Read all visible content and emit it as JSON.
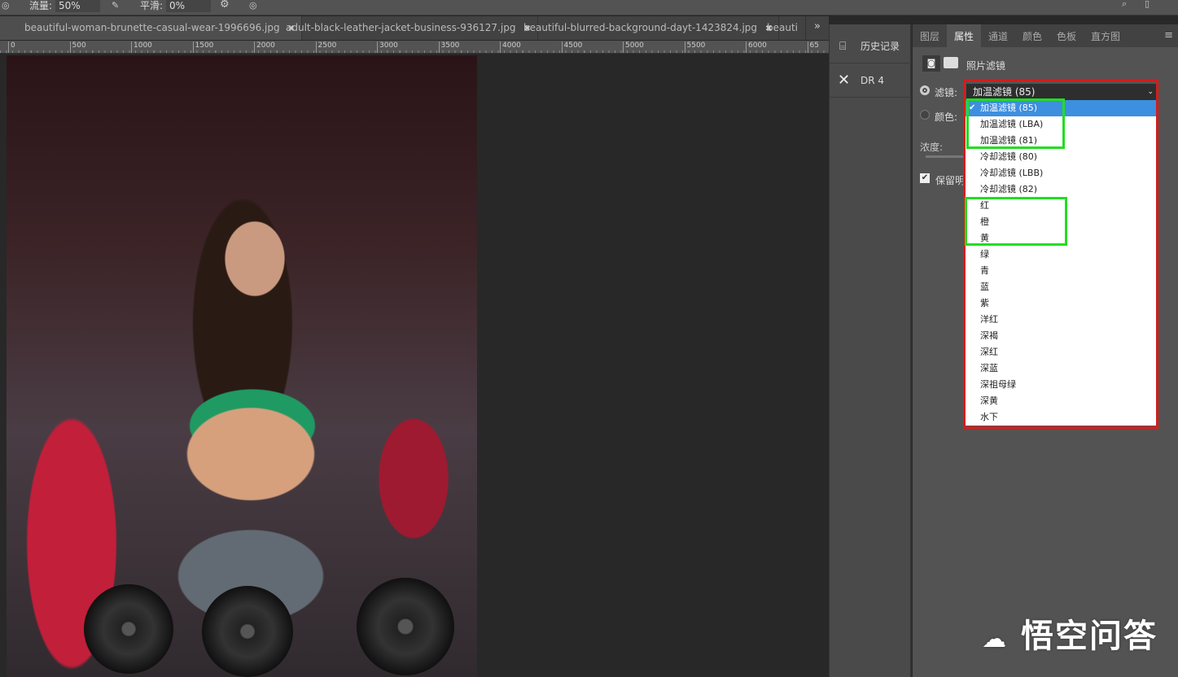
{
  "toolbar": {
    "flow_label": "流量:",
    "flow_value": "50%",
    "smooth_label": "平滑:",
    "smooth_value": "0%"
  },
  "tabs": [
    {
      "label": "beautiful-woman-brunette-casual-wear-1996696.jpg"
    },
    {
      "label": "adult-black-leather-jacket-business-936127.jpg"
    },
    {
      "label": "beautiful-blurred-background-dayt-1423824.jpg"
    },
    {
      "label": "beauti"
    }
  ],
  "tab_close": "✖",
  "overflow": "»",
  "ruler": [
    "0",
    "500",
    "1000",
    "1500",
    "2000",
    "2500",
    "3000",
    "3500",
    "4000",
    "4500",
    "5000",
    "5500",
    "6000",
    "65"
  ],
  "history": [
    {
      "label": "历史记录"
    },
    {
      "label": "DR 4"
    }
  ],
  "panel_tabs": [
    "图层",
    "属性",
    "通道",
    "颜色",
    "色板",
    "直方图"
  ],
  "props": {
    "title": "照片滤镜",
    "filter_label": "滤镜:",
    "filter_value": "加温滤镜 (85)",
    "color_label": "颜色:",
    "density_label": "浓度:",
    "preserve_label": "保留明"
  },
  "filter_options": [
    "加温滤镜 (85)",
    "加温滤镜 (LBA)",
    "加温滤镜 (81)",
    "冷却滤镜 (80)",
    "冷却滤镜 (LBB)",
    "冷却滤镜 (82)",
    "红",
    "橙",
    "黄",
    "绿",
    "青",
    "蓝",
    "紫",
    "洋红",
    "深褐",
    "深红",
    "深蓝",
    "深祖母绿",
    "深黄",
    "水下"
  ],
  "selected_index": 0,
  "highlight_colors": {
    "red": "#d81b1b",
    "green": "#22dd22"
  },
  "watermark": "悟空问答"
}
